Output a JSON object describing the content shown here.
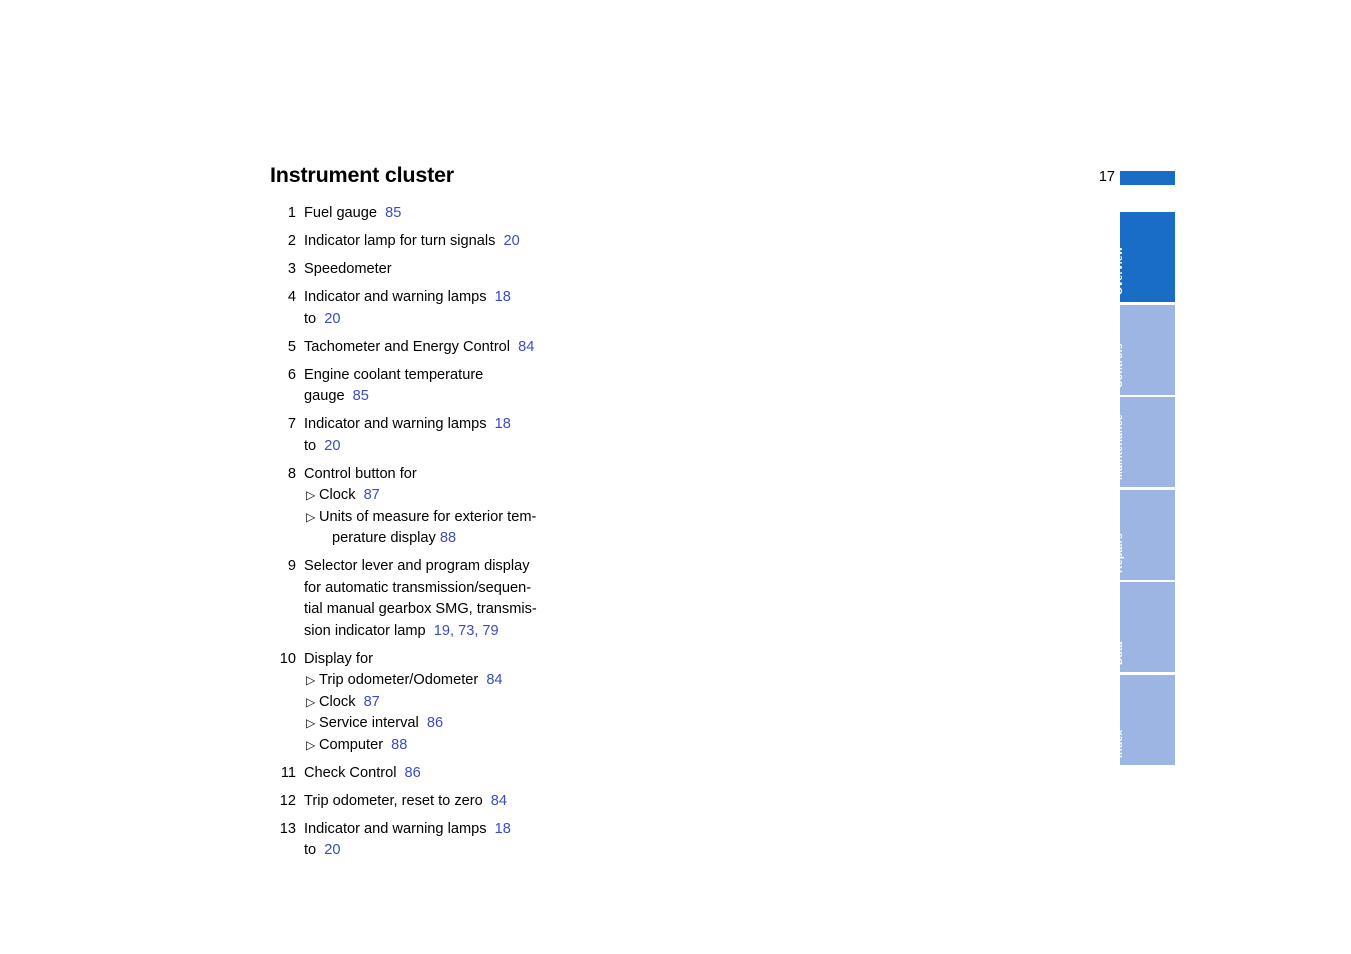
{
  "document": {
    "title": "Instrument cluster",
    "page_number": "17"
  },
  "legend": {
    "items": [
      {
        "number": "1",
        "lines": [
          {
            "text": "Fuel gauge",
            "ref": "85"
          }
        ]
      },
      {
        "number": "2",
        "lines": [
          {
            "text": "Indicator lamp for turn signals",
            "ref": "20"
          }
        ]
      },
      {
        "number": "3",
        "lines": [
          {
            "text": "Speedometer",
            "ref": ""
          }
        ]
      },
      {
        "number": "4",
        "lines": [
          {
            "text": "Indicator and warning lamps",
            "ref": "18"
          },
          {
            "text": "to",
            "ref": "20"
          }
        ]
      },
      {
        "number": "5",
        "lines": [
          {
            "text": "Tachometer and Energy Control",
            "ref": "84"
          }
        ]
      },
      {
        "number": "6",
        "lines": [
          {
            "text": "Engine coolant temperature",
            "ref": ""
          },
          {
            "text": "gauge",
            "ref": "85"
          }
        ]
      },
      {
        "number": "7",
        "lines": [
          {
            "text": "Indicator and warning lamps",
            "ref": "18"
          },
          {
            "text": "to",
            "ref": "20"
          }
        ]
      },
      {
        "number": "8",
        "lines": [
          {
            "text": "Control button for",
            "ref": ""
          }
        ],
        "sub": [
          {
            "bullet": "▷",
            "text": "Clock",
            "ref": "87"
          },
          {
            "bullet": "▷",
            "text": "Units of measure for exterior tem-",
            "ref": "",
            "cont_text": "perature display",
            "cont_ref": "88",
            "cont_tight": true
          }
        ]
      },
      {
        "number": "9",
        "lines": [
          {
            "text": "Selector lever and program display",
            "ref": ""
          },
          {
            "text": "for automatic transmission/sequen-",
            "ref": ""
          },
          {
            "text": "tial manual gearbox SMG, transmis-",
            "ref": ""
          },
          {
            "text": "sion indicator lamp",
            "ref": "19, 73, 79"
          }
        ]
      },
      {
        "number": "10",
        "lines": [
          {
            "text": "Display for",
            "ref": ""
          }
        ],
        "sub": [
          {
            "bullet": "▷",
            "text": "Trip odometer/Odometer",
            "ref": "84"
          },
          {
            "bullet": "▷",
            "text": "Clock",
            "ref": "87"
          },
          {
            "bullet": "▷",
            "text": "Service interval",
            "ref": "86"
          },
          {
            "bullet": "▷",
            "text": "Computer",
            "ref": "88"
          }
        ]
      },
      {
        "number": "11",
        "lines": [
          {
            "text": "Check Control",
            "ref": "86"
          }
        ]
      },
      {
        "number": "12",
        "lines": [
          {
            "text": "Trip odometer, reset to zero",
            "ref": "84"
          }
        ]
      },
      {
        "number": "13",
        "lines": [
          {
            "text": "Indicator and warning lamps",
            "ref": "18"
          },
          {
            "text": "to",
            "ref": "20"
          }
        ]
      }
    ]
  },
  "tabs": {
    "items": [
      {
        "label": "Overview",
        "active": true
      },
      {
        "label": "Controls",
        "active": false
      },
      {
        "label": "Maintenance",
        "active": false
      },
      {
        "label": "Repairs",
        "active": false
      },
      {
        "label": "Data",
        "active": false
      },
      {
        "label": "Index",
        "active": false
      }
    ]
  },
  "colors": {
    "accent_active": "#1A6DC4",
    "accent_inactive": "#9DB5E3",
    "reference_blue": "#3B4BC0",
    "text": "#000000"
  }
}
